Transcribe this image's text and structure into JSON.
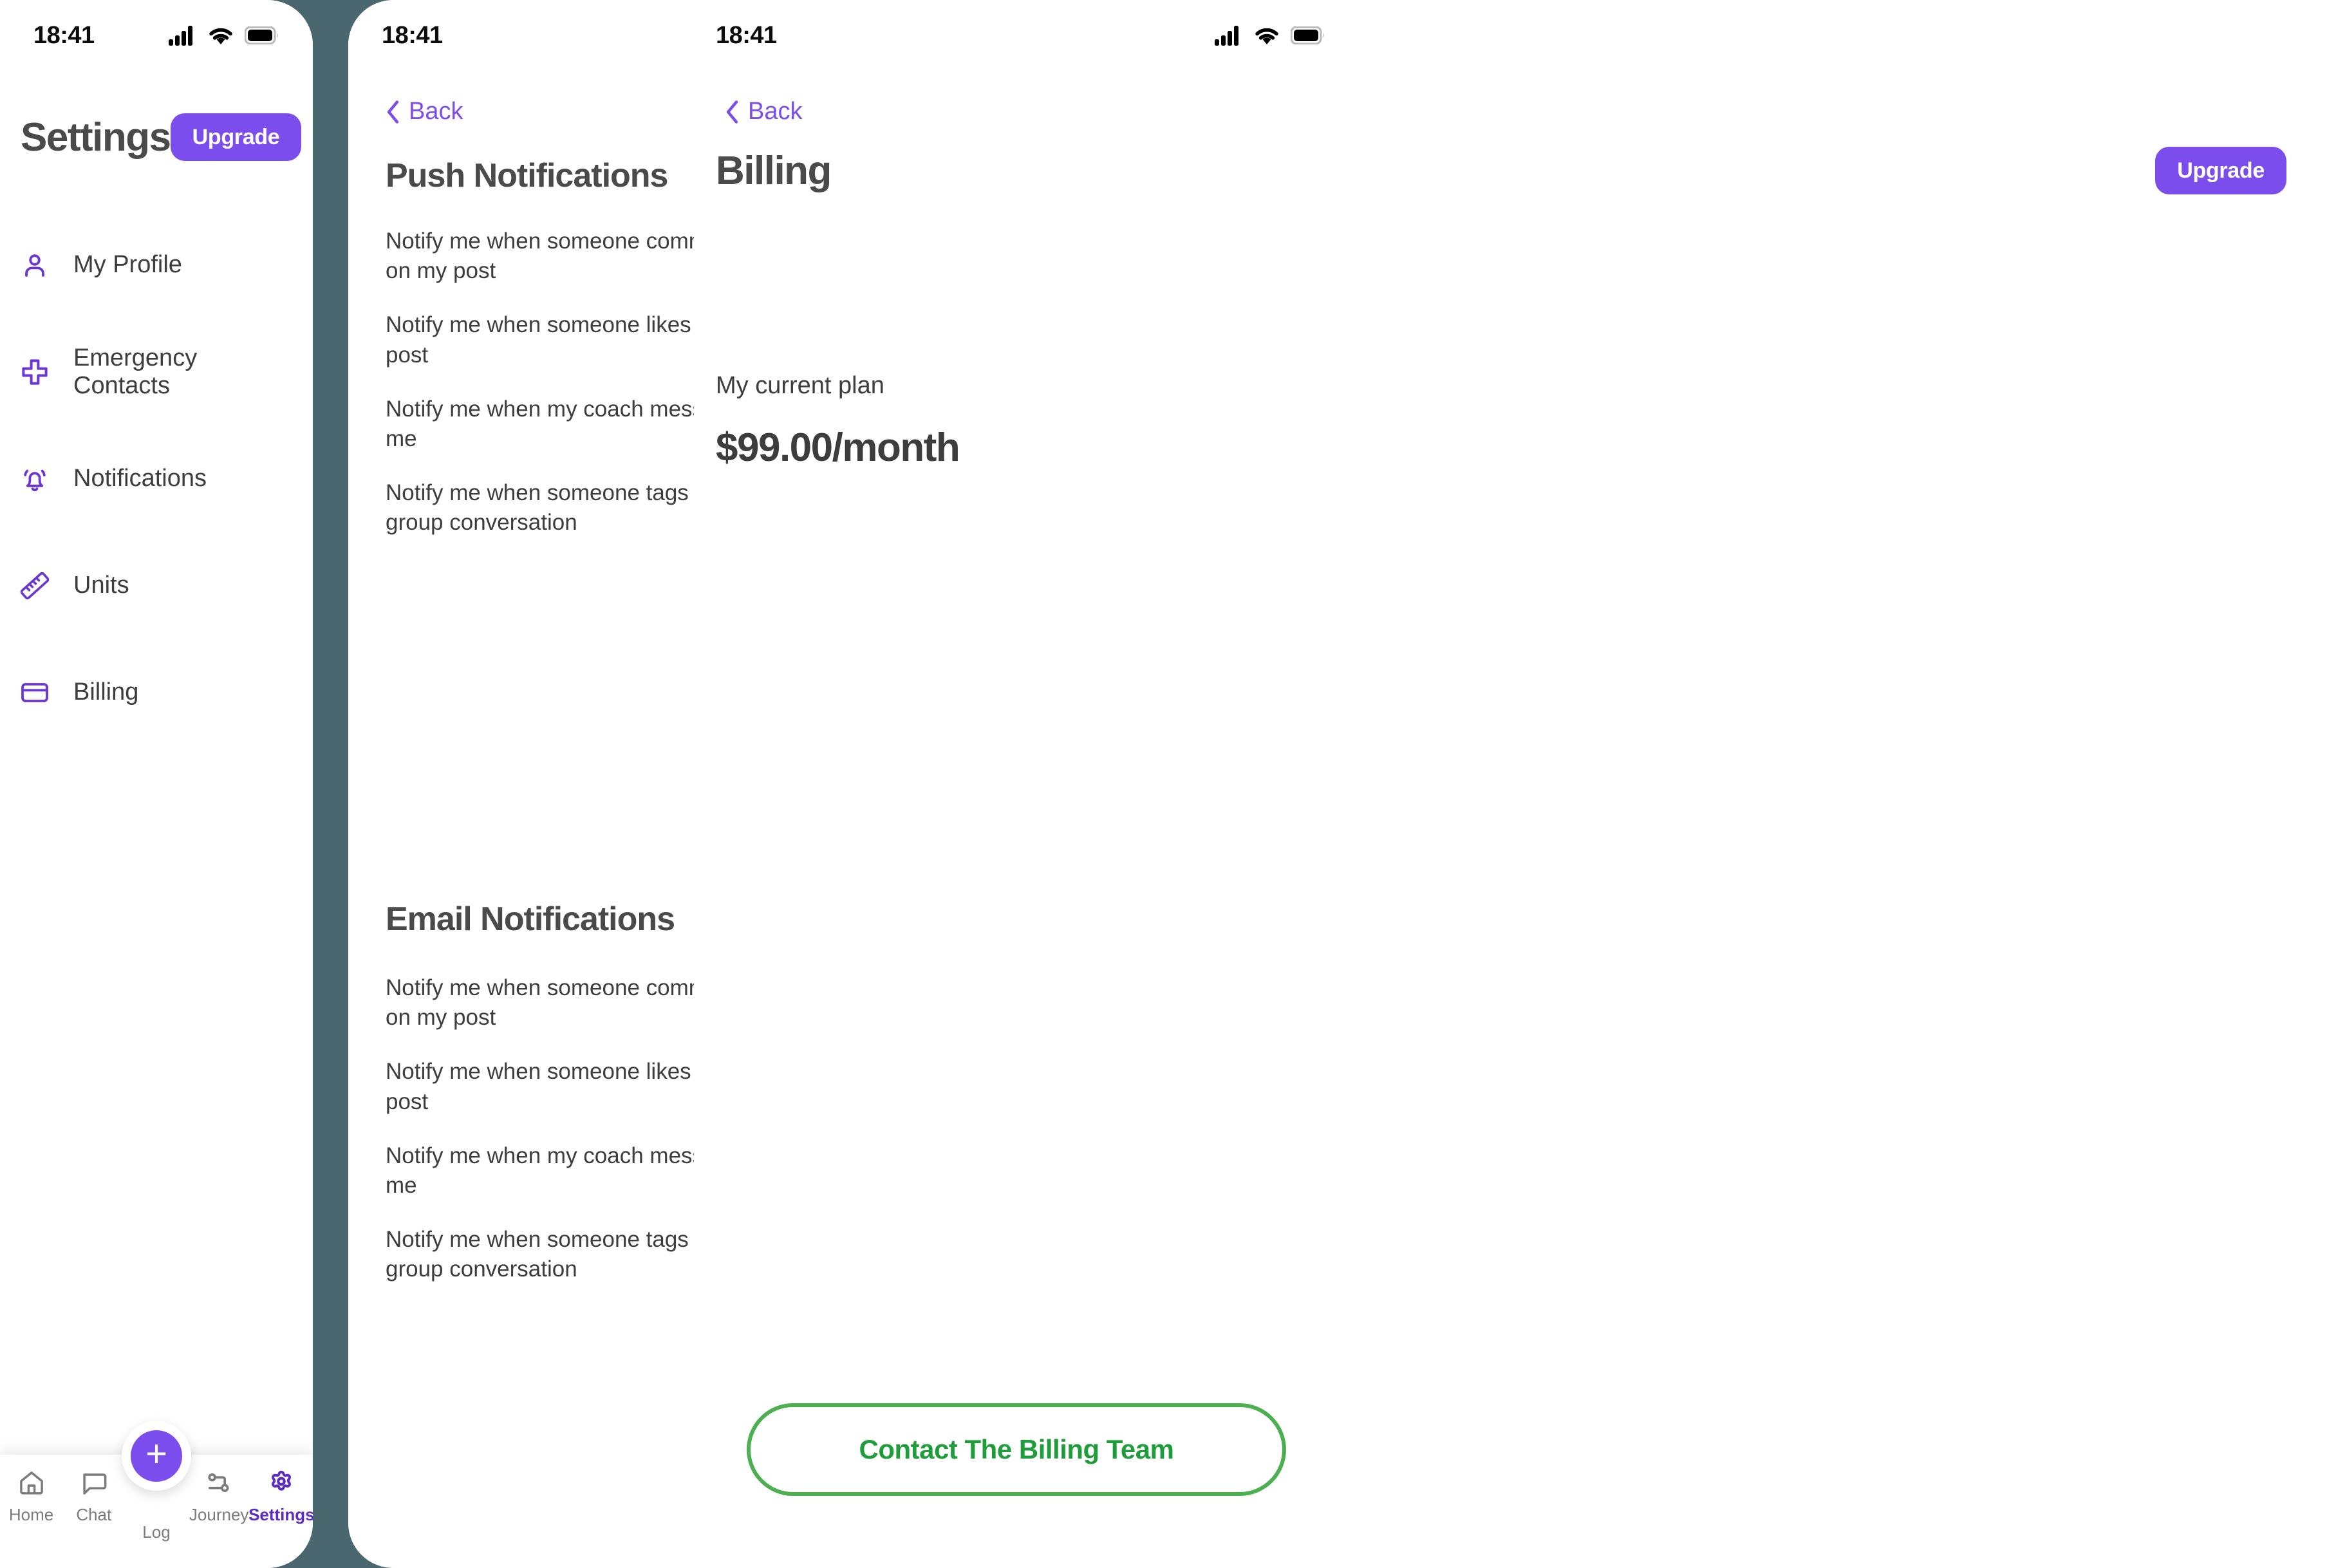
{
  "theme": {
    "background": "#4a6770",
    "accent_purple": "#7c4ded",
    "toggle_on_green": "#1f9d3a",
    "toggle_off_gray": "#d8d8d8",
    "contact_button_green": "#4caf50",
    "text_dark": "#3d3d3d"
  },
  "status_bar": {
    "time": "18:41",
    "icons": [
      "cellular-signal-icon",
      "wifi-icon",
      "battery-icon"
    ]
  },
  "settings_screen": {
    "title": "Settings",
    "upgrade_label": "Upgrade",
    "menu": [
      {
        "label": "My Profile",
        "icon": "person-icon"
      },
      {
        "label": "Emergency Contacts",
        "icon": "medical-cross-icon"
      },
      {
        "label": "Notifications",
        "icon": "bell-icon"
      },
      {
        "label": "Units",
        "icon": "ruler-icon"
      },
      {
        "label": "Billing",
        "icon": "credit-card-icon"
      }
    ],
    "tabbar": {
      "tabs": [
        {
          "label": "Home",
          "icon": "home-icon",
          "active": false
        },
        {
          "label": "Chat",
          "icon": "chat-bubble-icon",
          "active": false
        },
        {
          "label": "Log",
          "icon": "plus-icon",
          "active": false
        },
        {
          "label": "Journey",
          "icon": "journey-path-icon",
          "active": false
        },
        {
          "label": "Settings",
          "icon": "gear-icon",
          "active": true
        }
      ]
    }
  },
  "push_screen": {
    "back_label": "Back",
    "push_section_title": "Push Notifications",
    "email_section_title": "Email Notifications",
    "push_items": [
      {
        "label": "Notify me when someone comments on my post",
        "on": true
      },
      {
        "label": "Notify me when someone likes my post",
        "on": true
      },
      {
        "label": "Notify me when my coach messages me",
        "on": true
      },
      {
        "label": "Notify me when someone tags me in a group conversation",
        "on": true
      }
    ],
    "email_items": [
      {
        "label": "Notify me when someone comments on my post",
        "on": false
      },
      {
        "label": "Notify me when someone likes my post",
        "on": false
      },
      {
        "label": "Notify me when my coach messages me",
        "on": false
      },
      {
        "label": "Notify me when someone tags me in a group conversation",
        "on": false
      }
    ]
  },
  "billing_screen": {
    "back_label": "Back",
    "title": "Billing",
    "upgrade_label": "Upgrade",
    "plan_label": "My current plan",
    "plan_price": "$99.00/month",
    "contact_label": "Contact The Billing Team"
  }
}
